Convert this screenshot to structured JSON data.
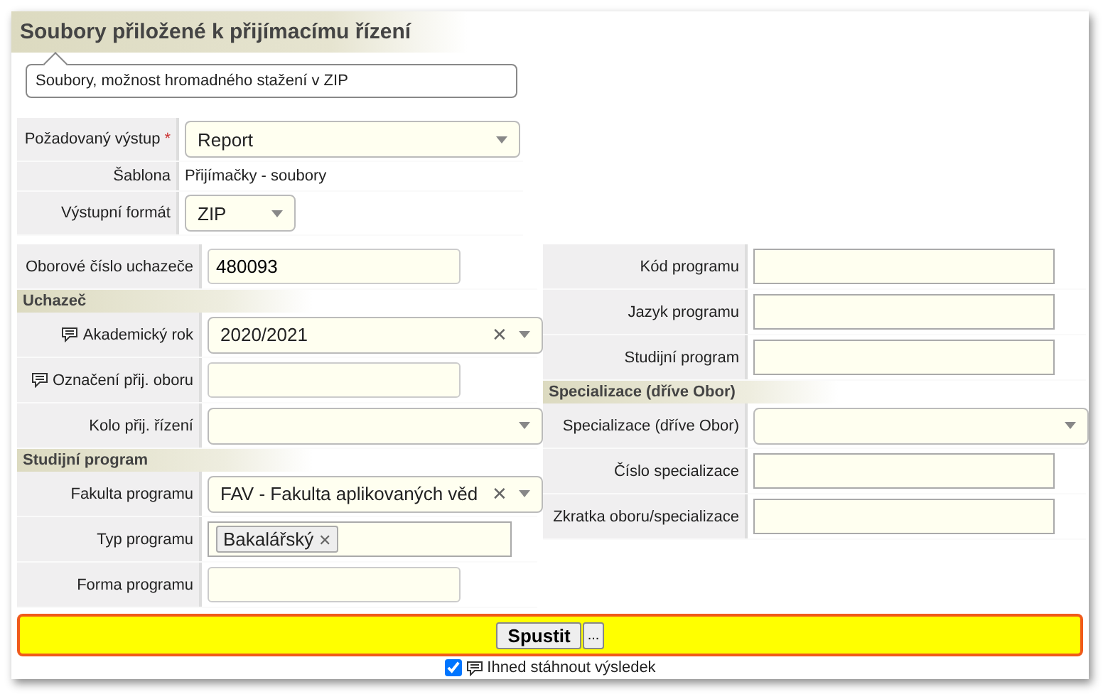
{
  "title": "Soubory přiložené k přijímacímu řízení",
  "description": "Soubory, možnost hromadného stažení v ZIP",
  "top_fields": [
    {
      "label": "Požadovaný výstup",
      "required": true,
      "kind": "select",
      "value": "Report"
    },
    {
      "label": "Šablona",
      "required": false,
      "kind": "text",
      "value": "Přijímačky - soubory"
    },
    {
      "label": "Výstupní formát",
      "required": false,
      "kind": "small-select",
      "value": "ZIP"
    }
  ],
  "left_fields": [
    {
      "kind": "input",
      "label": "Oborové číslo uchazeče",
      "value": "480093",
      "comment": false
    },
    {
      "kind": "heading",
      "label": "Uchazeč"
    },
    {
      "kind": "select",
      "label": "Akademický rok",
      "value": "2020/2021",
      "clearable": true,
      "comment": true
    },
    {
      "kind": "input",
      "label": "Označení přij. oboru",
      "comment": true
    },
    {
      "kind": "select",
      "label": "Kolo přij. řízení",
      "clearable": false,
      "comment": false
    },
    {
      "kind": "heading",
      "label": "Studijní program"
    },
    {
      "kind": "select",
      "label": "Fakulta programu",
      "value": "FAV - Fakulta aplikovaných věd",
      "clearable": true,
      "comment": false
    },
    {
      "kind": "tags",
      "label": "Typ programu",
      "tags": [
        "Bakalářský"
      ],
      "comment": false
    },
    {
      "kind": "input",
      "label": "Forma programu",
      "comment": false
    }
  ],
  "right_fields": [
    {
      "kind": "input",
      "label": "Kód programu",
      "comment": false
    },
    {
      "kind": "input",
      "label": "Jazyk programu",
      "comment": false
    },
    {
      "kind": "input",
      "label": "Studijní program",
      "comment": false
    },
    {
      "kind": "heading",
      "label": "Specializace (dříve Obor)"
    },
    {
      "kind": "select",
      "label": "Specializace (dříve Obor)",
      "clearable": false,
      "comment": false
    },
    {
      "kind": "input",
      "label": "Číslo specializace",
      "comment": false
    },
    {
      "kind": "input",
      "label": "Zkratka oboru/specializace",
      "comment": false
    }
  ],
  "required_mark": "*",
  "clear_glyph": "✕",
  "run_button": "Spustit",
  "more_button": "...",
  "download": {
    "checked": true,
    "label": "Ihned stáhnout výsledek",
    "comment": true
  }
}
